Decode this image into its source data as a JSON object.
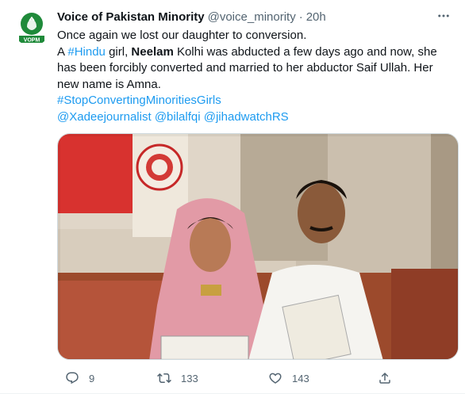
{
  "colors": {
    "text": "#0f1419",
    "secondary": "#536471",
    "link": "#1d9bf0",
    "divider": "#eff3f4",
    "avatar_green": "#1f8a3a"
  },
  "tweet": {
    "author": {
      "display_name": "Voice of Pakistan Minority",
      "handle": "@voice_minority",
      "separator": "·",
      "time": "20h",
      "avatar_label": "VOPM"
    },
    "text": {
      "line1": "Once again we lost our daughter to conversion.",
      "p2_a": "A ",
      "p2_hashtag": "#Hindu",
      "p2_b": " girl, ",
      "p2_name": "Neelam",
      "p2_c": " Kolhi was abducted a few days ago and now, she has been forcibly converted and married to her abductor Saif Ullah. Her new name is Amna.",
      "hashtag2": "#StopConvertingMinoritiesGirls",
      "mention1": "@Xadeejournalist",
      "mention2": "@bilalfqi",
      "mention3": "@jihadwatchRS"
    },
    "media": {
      "icon": "photo"
    },
    "actions": {
      "reply": {
        "icon": "reply-icon",
        "count": "9"
      },
      "retweet": {
        "icon": "retweet-icon",
        "count": "133"
      },
      "like": {
        "icon": "heart-icon",
        "count": "143"
      },
      "share": {
        "icon": "share-icon",
        "count": ""
      }
    }
  }
}
